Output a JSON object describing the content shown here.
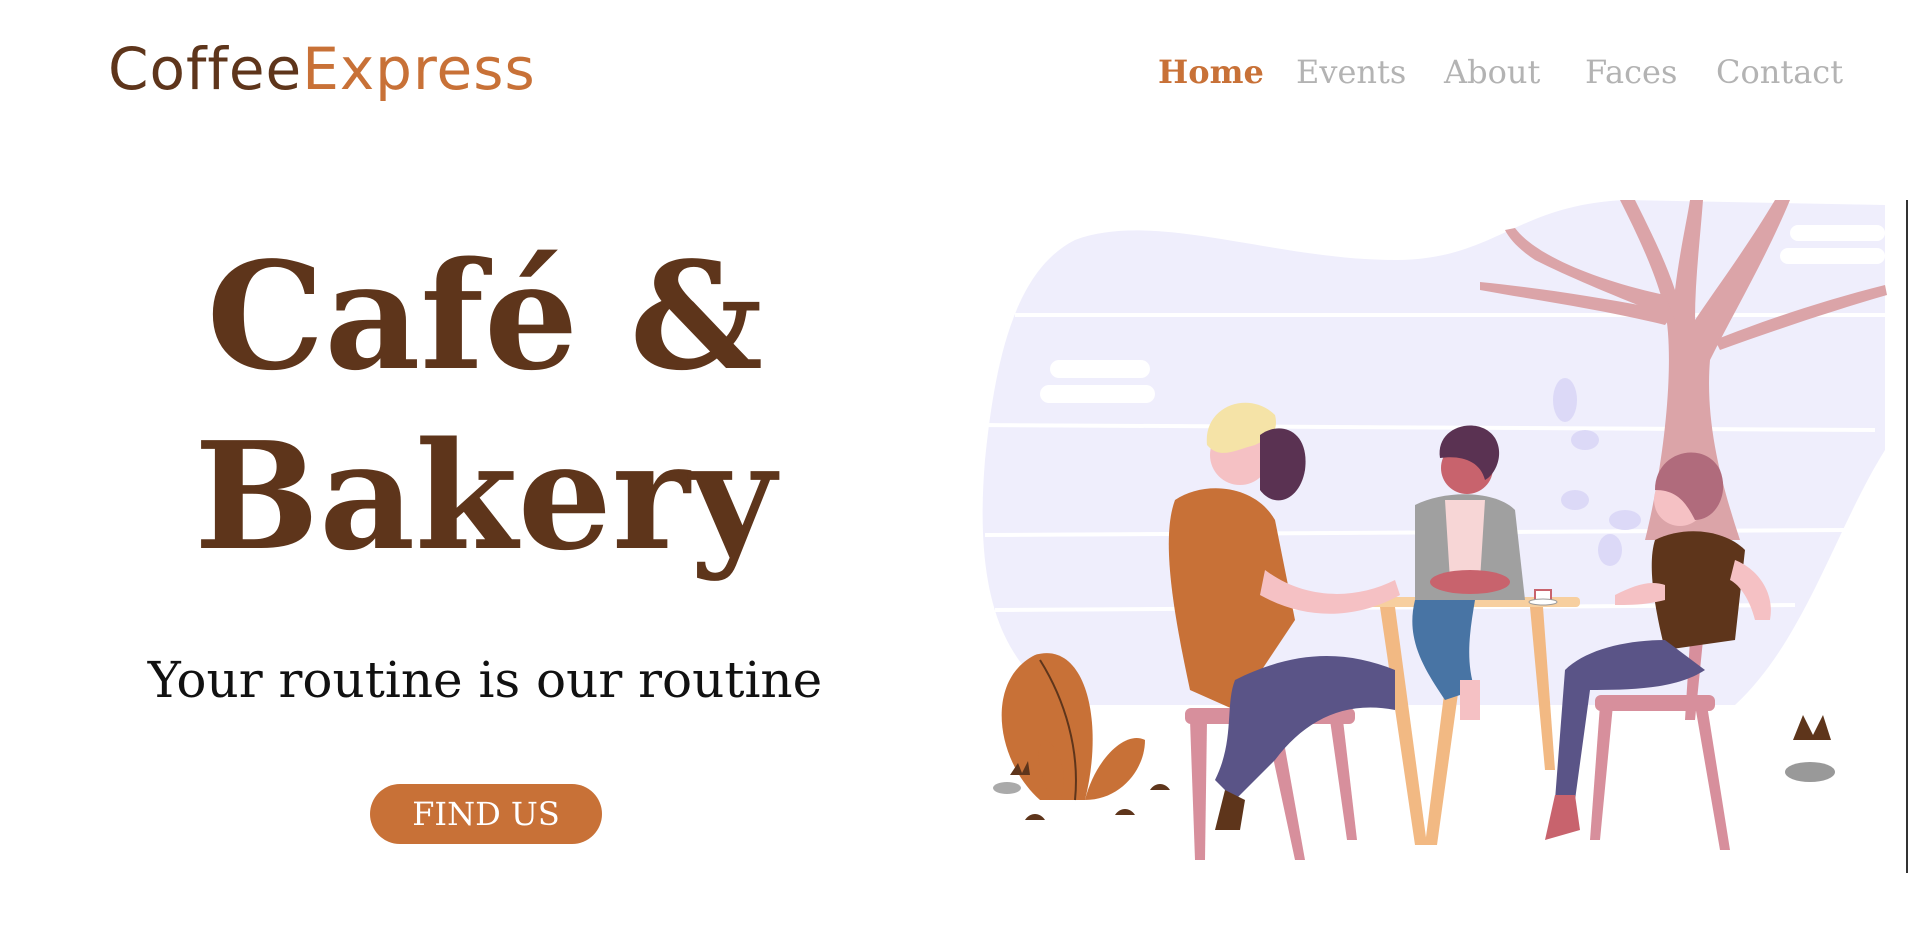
{
  "header": {
    "logo": {
      "part1": "Coffee",
      "part2": "Express"
    },
    "nav": [
      {
        "label": "Home",
        "active": true
      },
      {
        "label": "Events",
        "active": false
      },
      {
        "label": "About",
        "active": false
      },
      {
        "label": "Faces",
        "active": false
      },
      {
        "label": "Contact",
        "active": false
      }
    ]
  },
  "hero": {
    "title_line1": "Café &",
    "title_line2": "Bakery",
    "tagline": "Your routine is our routine",
    "cta_label": "FIND US"
  },
  "illustration": {
    "icon": "people-at-cafe-table-illustration"
  },
  "colors": {
    "brown": "#5e351b",
    "accent": "#c87137",
    "nav_inactive": "#b3b3b3",
    "sky": "#efeefc",
    "tree": "#dba4a8"
  }
}
